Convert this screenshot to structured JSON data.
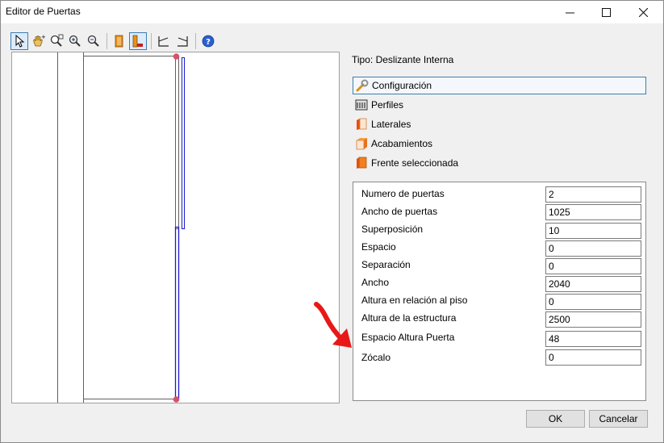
{
  "window": {
    "title": "Editor de Puertas"
  },
  "titlebar_icons": {
    "minimize": "minimize-icon",
    "maximize": "maximize-icon",
    "close": "close-icon"
  },
  "toolbar": {
    "tools": [
      {
        "name": "select-tool",
        "icon": "cursor-arrow-icon",
        "active": true
      },
      {
        "name": "pan-tool",
        "icon": "hand-pan-icon",
        "active": false
      },
      {
        "name": "zoom-window-tool",
        "icon": "zoom-window-icon",
        "active": false
      },
      {
        "name": "zoom-in-tool",
        "icon": "zoom-in-icon",
        "active": false
      },
      {
        "name": "zoom-out-tool",
        "icon": "zoom-out-icon",
        "active": false
      },
      {
        "name": "view-front-tool",
        "icon": "door-front-icon",
        "active": false
      },
      {
        "name": "view-section-tool",
        "icon": "door-section-icon",
        "active": true
      },
      {
        "name": "frame-left-tool",
        "icon": "frame-left-icon",
        "active": false
      },
      {
        "name": "frame-right-tool",
        "icon": "frame-right-icon",
        "active": false
      },
      {
        "name": "help-tool",
        "icon": "help-icon",
        "active": false
      }
    ]
  },
  "info": {
    "tipo": "Tipo: Deslizante Interna"
  },
  "panel": {
    "items": [
      {
        "label": "Configuración",
        "icon": "wrench-icon",
        "selected": true
      },
      {
        "label": "Perfiles",
        "icon": "profiles-icon",
        "selected": false
      },
      {
        "label": "Laterales",
        "icon": "side-panel-icon",
        "selected": false
      },
      {
        "label": "Acabamientos",
        "icon": "finish-icon",
        "selected": false
      },
      {
        "label": "Frente seleccionada",
        "icon": "front-selected-icon",
        "selected": false
      }
    ]
  },
  "properties": [
    {
      "label": "Numero de puertas",
      "value": "2"
    },
    {
      "label": "Ancho de puertas",
      "value": "1025"
    },
    {
      "label": "Superposición",
      "value": "10"
    },
    {
      "label": "Espacio",
      "value": "0"
    },
    {
      "label": "Separación",
      "value": "0"
    },
    {
      "label": "Ancho",
      "value": "2040"
    },
    {
      "label": "Altura en relación al piso",
      "value": "0"
    },
    {
      "label": "Altura de la estructura",
      "value": "2500"
    },
    {
      "label": "Espacio Altura Puerta",
      "value": "48"
    },
    {
      "label": "Zócalo",
      "value": "0"
    }
  ],
  "buttons": {
    "ok": "OK",
    "cancel": "Cancelar"
  },
  "colors": {
    "accent": "#3c7fb1",
    "arrow": "#e81818",
    "door_line": "#1a1acc",
    "marker": "#d9506a"
  }
}
